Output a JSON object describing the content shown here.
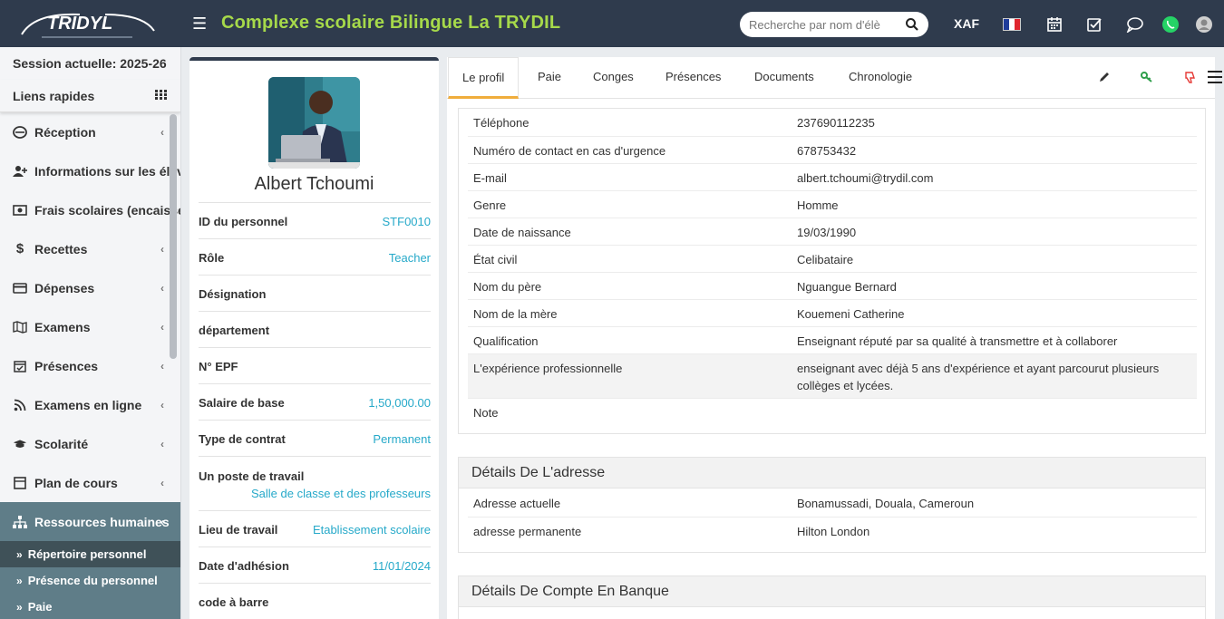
{
  "header": {
    "school_name": "Complexe scolaire Bilingue La TRYDIL",
    "search_placeholder": "Recherche par nom d'élè",
    "currency": "XAF",
    "logo_text": "TRIDYL"
  },
  "sidebar": {
    "session": "Session actuelle: 2025-26",
    "quick_links": "Liens rapides",
    "items": [
      {
        "label": "Réception",
        "icon": "reception-icon"
      },
      {
        "label": "Informations sur les élèves",
        "icon": "add-user-icon"
      },
      {
        "label": "Frais scolaires (encaissement)",
        "icon": "money-icon"
      },
      {
        "label": "Recettes",
        "icon": "dollar-icon"
      },
      {
        "label": "Dépenses",
        "icon": "credit-card-icon"
      },
      {
        "label": "Examens",
        "icon": "map-icon"
      },
      {
        "label": "Présences",
        "icon": "calendar-check-icon"
      },
      {
        "label": "Examens en ligne",
        "icon": "rss-icon"
      },
      {
        "label": "Scolarité",
        "icon": "graduation-cap-icon"
      },
      {
        "label": "Plan de cours",
        "icon": "book-icon"
      },
      {
        "label": "Ressources humaines",
        "icon": "sitemap-icon"
      }
    ],
    "sub_items": [
      {
        "label": "Répertoire personnel"
      },
      {
        "label": "Présence du personnel"
      },
      {
        "label": "Paie"
      }
    ]
  },
  "profile": {
    "name": "Albert Tchoumi",
    "rows": [
      {
        "label": "ID du personnel",
        "value": "STF0010"
      },
      {
        "label": "Rôle",
        "value": "Teacher"
      },
      {
        "label": "Désignation",
        "value": ""
      },
      {
        "label": "département",
        "value": ""
      },
      {
        "label": "N° EPF",
        "value": ""
      },
      {
        "label": "Salaire de base",
        "value": "1,50,000.00"
      },
      {
        "label": "Type de contrat",
        "value": "Permanent"
      },
      {
        "label": "Un poste de travail",
        "value": "Salle de classe et des professeurs"
      },
      {
        "label": "Lieu de travail",
        "value": "Etablissement scolaire"
      },
      {
        "label": "Date d'adhésion",
        "value": "11/01/2024"
      },
      {
        "label": "code à barre",
        "value": ""
      }
    ]
  },
  "tabs": [
    "Le profil",
    "Paie",
    "Conges",
    "Présences",
    "Documents",
    "Chronologie"
  ],
  "details": [
    {
      "label": "Téléphone",
      "value": "237690112235"
    },
    {
      "label": "Numéro de contact en cas d'urgence",
      "value": "678753432"
    },
    {
      "label": "E-mail",
      "value": "albert.tchoumi@trydil.com"
    },
    {
      "label": "Genre",
      "value": "Homme"
    },
    {
      "label": "Date de naissance",
      "value": "19/03/1990"
    },
    {
      "label": "État civil",
      "value": "Celibataire"
    },
    {
      "label": "Nom du père",
      "value": "Nguangue Bernard"
    },
    {
      "label": "Nom de la mère",
      "value": "Kouemeni Catherine"
    },
    {
      "label": "Qualification",
      "value": "Enseignant réputé par sa qualité à transmettre et à collaborer"
    },
    {
      "label": "L'expérience professionnelle",
      "value": "enseignant avec déjà 5 ans d'expérience et ayant parcourut plusieurs collèges et lycées."
    },
    {
      "label": "Note",
      "value": ""
    }
  ],
  "address": {
    "title": "Détails De L'adresse",
    "rows": [
      {
        "label": "Adresse actuelle",
        "value": "Bonamussadi, Douala, Cameroun"
      },
      {
        "label": "adresse permanente",
        "value": "Hilton London"
      }
    ]
  },
  "bank": {
    "title": "Détails De Compte En Banque"
  },
  "colors": {
    "header_bg": "#2f3b4d",
    "school_name": "#a6d94a",
    "link": "#26a9c9",
    "sidebar_active": "#5f7d88",
    "tab_accent": "#f0ad3c"
  }
}
